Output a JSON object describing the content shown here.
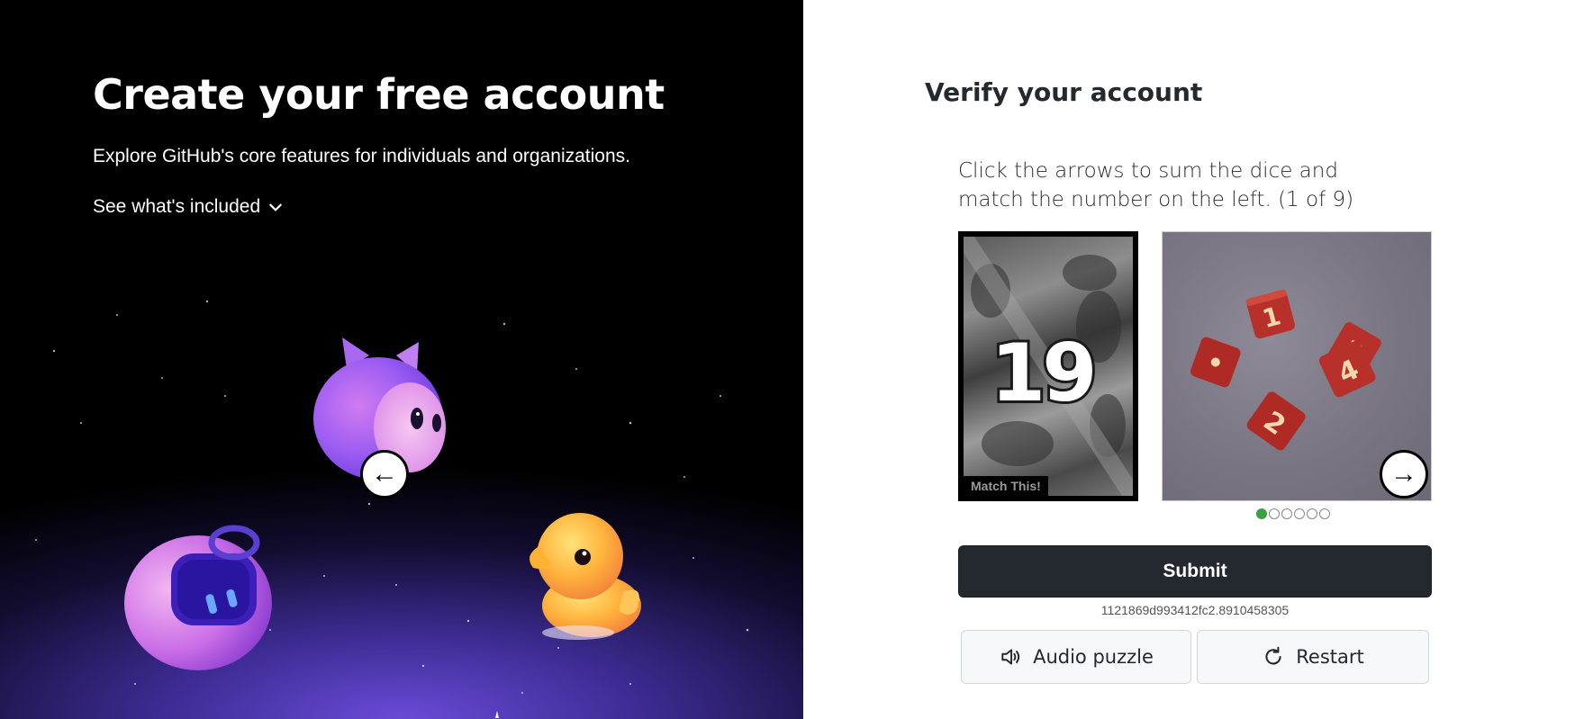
{
  "left": {
    "title": "Create your free account",
    "subtitle": "Explore GitHub's core features for individuals and organizations.",
    "included_label": "See what's included",
    "included_icon": "chevron-down-icon"
  },
  "verify": {
    "title": "Verify your account",
    "instruction": "Click the arrows to sum the dice and match the number on the left. (1 of 9)",
    "match_number": "19",
    "match_label": "Match This!",
    "dice_values": [
      "1",
      "3",
      "4",
      "2"
    ],
    "left_arrow": "←",
    "right_arrow": "→",
    "dots_total": 6,
    "dots_active_index": 0,
    "submit_label": "Submit",
    "session_id": "1121869d993412fc2.8910458305",
    "audio_label": "Audio puzzle",
    "restart_label": "Restart"
  },
  "colors": {
    "dark_button": "#24292f",
    "dot_active": "#3aa142",
    "die_red": "#b8302a"
  }
}
